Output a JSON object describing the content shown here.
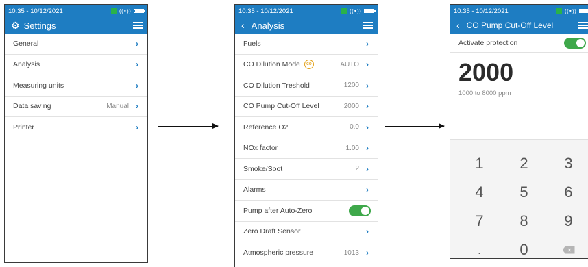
{
  "status": {
    "time": "10:35 - 10/12/2021"
  },
  "screen1": {
    "title": "Settings",
    "items": [
      {
        "label": "General",
        "value": ""
      },
      {
        "label": "Analysis",
        "value": ""
      },
      {
        "label": "Measuring units",
        "value": ""
      },
      {
        "label": "Data saving",
        "value": "Manual"
      },
      {
        "label": "Printer",
        "value": ""
      }
    ]
  },
  "screen2": {
    "title": "Analysis",
    "items": [
      {
        "label": "Fuels",
        "value": ""
      },
      {
        "label": "CO Dilution Mode",
        "value": "AUTO",
        "icon": "co-dilution-icon",
        "icon_text": "CO"
      },
      {
        "label": "CO Dilution Treshold",
        "value": "1200"
      },
      {
        "label": "CO Pump Cut-Off Level",
        "value": "2000"
      },
      {
        "label": "Reference O2",
        "value": "0.0"
      },
      {
        "label": "NOx factor",
        "value": "1.00"
      },
      {
        "label": "Smoke/Soot",
        "value": "2"
      },
      {
        "label": "Alarms",
        "value": ""
      },
      {
        "label": "Pump after Auto-Zero",
        "value": "",
        "toggle": true
      },
      {
        "label": "Zero Draft Sensor",
        "value": ""
      },
      {
        "label": "Atmospheric pressure",
        "value": "1013"
      }
    ]
  },
  "screen3": {
    "title": "CO Pump Cut-Off Level",
    "activate_label": "Activate protection",
    "value": "2000",
    "range": "1000 to 8000 ppm",
    "keys": [
      "1",
      "2",
      "3",
      "4",
      "5",
      "6",
      "7",
      "8",
      "9",
      ".",
      "0",
      "⌫"
    ]
  },
  "colors": {
    "header": "#1e7dc2",
    "toggle_on": "#3ea84a",
    "chevron": "#1e7dc2"
  }
}
